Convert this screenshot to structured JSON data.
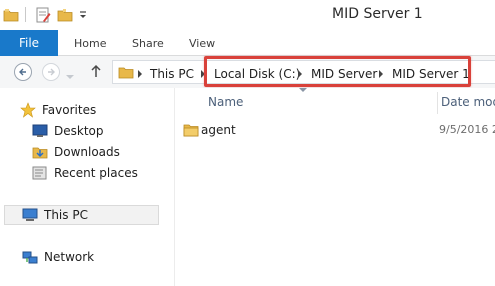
{
  "window": {
    "title": "MID Server 1"
  },
  "quick_access": {
    "icons": [
      "folder-icon",
      "properties-icon",
      "new-folder-icon",
      "customize-dropdown-icon"
    ]
  },
  "ribbon": {
    "tabs": [
      "File",
      "Home",
      "Share",
      "View"
    ]
  },
  "address": {
    "crumbs": [
      "This PC",
      "Local Disk (C:)",
      "MID Server",
      "MID Server 1"
    ]
  },
  "nav": {
    "favorites": "Favorites",
    "desktop": "Desktop",
    "downloads": "Downloads",
    "recent": "Recent places",
    "this_pc": "This PC",
    "network": "Network"
  },
  "columns": {
    "name": "Name",
    "date": "Date modi"
  },
  "files": [
    {
      "name": "agent",
      "date": "9/5/2016 2",
      "icon": "folder-icon"
    }
  ],
  "colors": {
    "file_tab": "#1979ca",
    "highlight": "#d9413a",
    "folder": "#e8b84a"
  }
}
